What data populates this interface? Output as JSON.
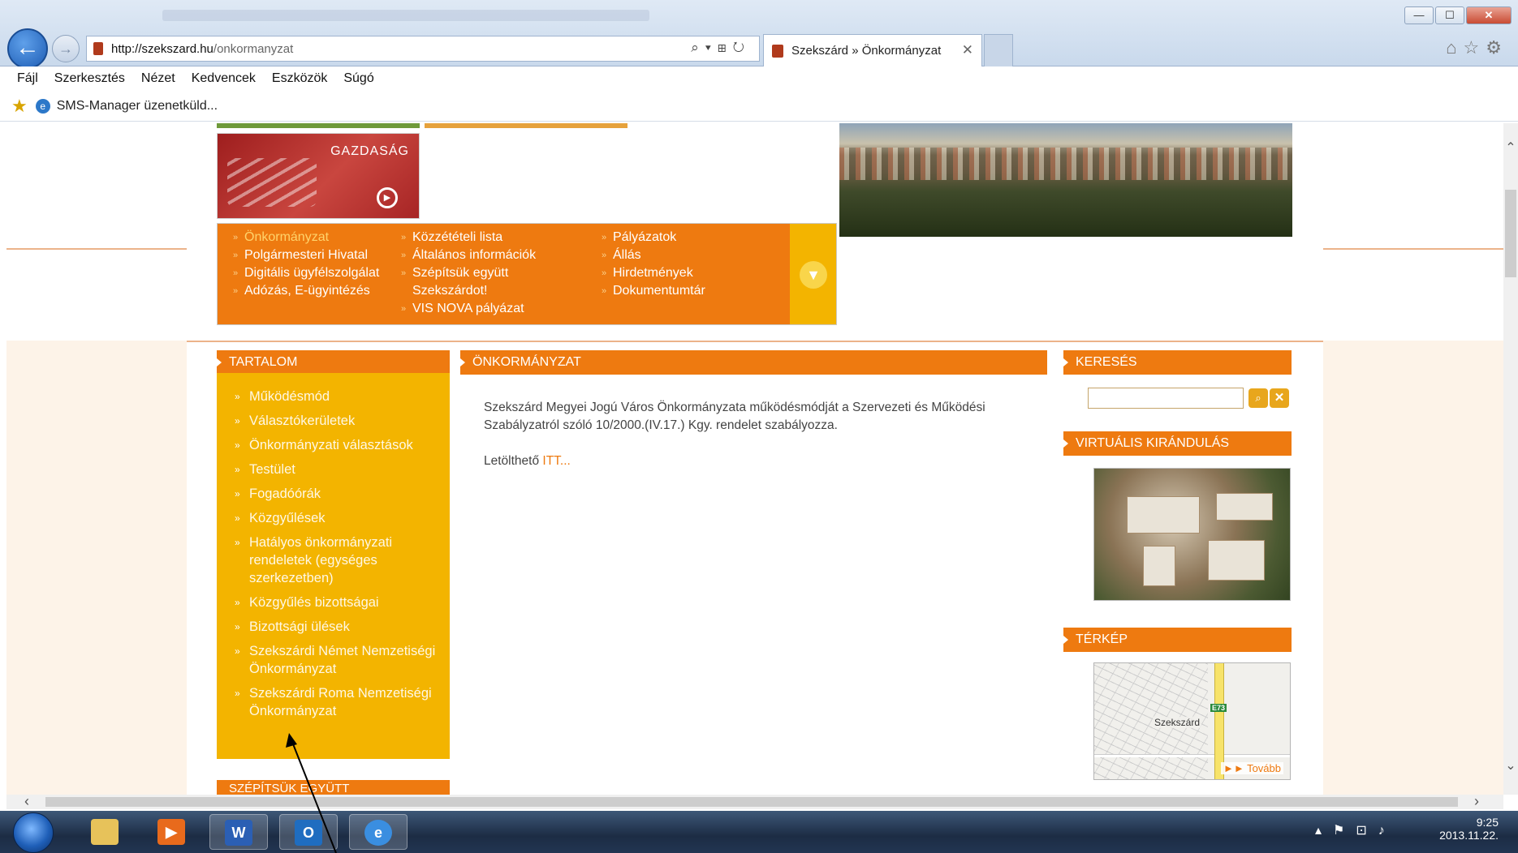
{
  "browser": {
    "url_host": "http://szekszard.hu",
    "url_path": "/onkormanyzat",
    "tab_title": "Szekszárd » Önkormányzat",
    "tab_close": "✕",
    "menu": [
      "Fájl",
      "Szerkesztés",
      "Nézet",
      "Kedvencek",
      "Eszközök",
      "Súgó"
    ],
    "favorites": [
      "SMS-Manager üzenetküld..."
    ],
    "window_buttons": {
      "minimize": "—",
      "maximize": "☐",
      "close": "✕"
    }
  },
  "page": {
    "tile_gazdasag": "GAZDASÁG",
    "nav": {
      "col1": [
        "Önkormányzat",
        "Polgármesteri Hivatal",
        "Digitális ügyfélszolgálat",
        "Adózás, E-ügyintézés"
      ],
      "col2": [
        "Közzétételi lista",
        "Általános információk",
        "Szépítsük együtt",
        "Szekszárdot!",
        "VIS NOVA pályázat"
      ],
      "col3": [
        "Pályázatok",
        "Állás",
        "Hirdetmények",
        "Dokumentumtár"
      ],
      "expand_glyph": "▼"
    },
    "sidebar": {
      "title": "TARTALOM",
      "items": [
        "Működésmód",
        "Választókerületek",
        "Önkormányzati választások",
        "Testület",
        "Fogadóórák",
        "Közgyűlések",
        "Hatályos önkormányzati rendeletek (egységes szerkezetben)",
        "Közgyűlés bizottságai",
        "Bizottsági ülések",
        "Szekszárdi Német Nemzetiségi Önkormányzat",
        "Szekszárdi Roma Nemzetiségi Önkormányzat"
      ],
      "next_section": "SZÉPÍTSÜK EGYÜTT"
    },
    "main": {
      "title": "ÖNKORMÁNYZAT",
      "paragraph": "Szekszárd Megyei Jogú Város Önkormányzata működésmódját a Szervezeti és Működési Szabályzatról szóló 10/2000.(IV.17.) Kgy. rendelet szabályozza.",
      "download_label": "Letölthető",
      "download_link": "ITT..."
    },
    "right": {
      "search_title": "KERESÉS",
      "search_value": "",
      "virtual_title": "VIRTUÁLIS KIRÁNDULÁS",
      "map_title": "TÉRKÉP",
      "map_city": "Szekszárd",
      "map_road": "E73",
      "map_more": "►► Tovább"
    }
  },
  "taskbar": {
    "time": "9:25",
    "date": "2013.11.22."
  },
  "colors": {
    "accent_orange": "#ee7a10",
    "sidebar_yellow": "#f3b400",
    "link_orange": "#ee7a10"
  }
}
